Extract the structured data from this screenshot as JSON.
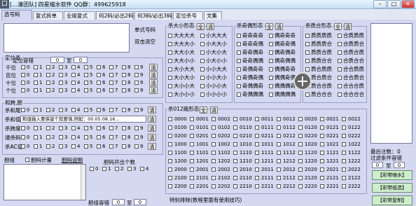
{
  "window": {
    "title": "[…清团队] 四星缩水软件 QQ群：499625918",
    "icon_char": "口"
  },
  "tabs": [
    {
      "label": "选号码"
    },
    {
      "label": "复式拆单"
    },
    {
      "label": "业级复式"
    },
    {
      "label": "何2码/必出2码"
    },
    {
      "label": "何3码/必出3码"
    },
    {
      "label": "定位杀号"
    },
    {
      "label": "文集"
    }
  ],
  "top_left": {
    "single_btn": "单式号码",
    "dbl_clear": "双击清空"
  },
  "dingwei": {
    "group_title": "定位杀",
    "tolerance_label": "定位容错",
    "tol_from": "0",
    "tol_to_label": "至",
    "tol_to": "0",
    "rows": [
      {
        "label": "千位"
      },
      {
        "label": "百位"
      },
      {
        "label": "十位"
      },
      {
        "label": "个位"
      }
    ],
    "digits": [
      "0",
      "1",
      "2",
      "3",
      "4",
      "5",
      "6",
      "7",
      "8",
      "9"
    ],
    "clear": "清"
  },
  "hehe": {
    "group_title": "和跨,胆",
    "rows": [
      {
        "label": "杀和尾"
      },
      {
        "label": "杀和值"
      },
      {
        "label": "杀跨度"
      },
      {
        "label": "通杀码"
      },
      {
        "label": "杀AC值"
      }
    ],
    "digits": [
      "0",
      "1",
      "2",
      "3",
      "4",
      "5",
      "6",
      "7",
      "8",
      "9"
    ],
    "sum_value_placeholder": "和值输入要保留个就要填,例如：00.05.08.16...",
    "clear": "清"
  },
  "danzu": {
    "label": "胆组",
    "code_count": "胆码计量",
    "explain": "胆码说明",
    "out_count": "胆码开出个数",
    "digits": [
      "0",
      "1",
      "2",
      "3",
      "4"
    ],
    "tolerance_label": "胆组容错",
    "tol_from": "0",
    "tol_to_label": "至",
    "tol_to": "0"
  },
  "daxiao": {
    "title": "杀大小形态",
    "all": "全",
    "clear": "清",
    "items": [
      "大大大大",
      "大大大小",
      "大大小大",
      "大大小小",
      "大小大大",
      "大小大小",
      "大小小大",
      "大小小小",
      "小大大大",
      "小大大小",
      "小大小大",
      "小大小小",
      "小小大大",
      "小小大小",
      "小小小大",
      "小小小小"
    ]
  },
  "jiou": {
    "title": "杀奇偶形态",
    "all": "全",
    "clear": "清",
    "items": [
      "奇奇奇奇",
      "奇奇奇偶",
      "奇奇偶奇",
      "奇奇偶偶",
      "奇偶奇奇",
      "奇偶奇偶",
      "奇偶偶奇",
      "奇偶偶偶",
      "偶奇奇奇",
      "偶奇奇偶",
      "偶奇偶奇",
      "偶奇偶偶",
      "偶偶奇奇",
      "偶偶奇偶",
      "偶偶偶奇",
      "偶偶偶偶"
    ]
  },
  "zhihe": {
    "title": "杀质合形态",
    "all": "全",
    "clear": "清",
    "items": [
      "质质质质",
      "质质质合",
      "质质合质",
      "质质合合",
      "质合质质",
      "质合质合",
      "质合合质",
      "质合合合",
      "合质质质",
      "合质质合",
      "合质合质",
      "合质合合",
      "合合质质",
      "合合质合",
      "合合合质",
      "合合合合"
    ]
  },
  "lu012": {
    "title": "杀012路形态",
    "all": "全",
    "clear": "清",
    "codes": [
      "0000",
      "0001",
      "0002",
      "0010",
      "0011",
      "0012",
      "0020",
      "0021",
      "0022",
      "0100",
      "0101",
      "0102",
      "0110",
      "0111",
      "0112",
      "0120",
      "0121",
      "0122",
      "0200",
      "0201",
      "0202",
      "0210",
      "0211",
      "0212",
      "0220",
      "0221",
      "0222",
      "1000",
      "1001",
      "1002",
      "1010",
      "1011",
      "1012",
      "1020",
      "1021",
      "1022",
      "1100",
      "1101",
      "1102",
      "1110",
      "1111",
      "1112",
      "1120",
      "1121",
      "1122",
      "1200",
      "1201",
      "1202",
      "1210",
      "1211",
      "1212",
      "1220",
      "1221",
      "1222",
      "2000",
      "2001",
      "2002",
      "2010",
      "2011",
      "2012",
      "2020",
      "2021",
      "2022",
      "2100",
      "2101",
      "2102",
      "2110",
      "2111",
      "2112",
      "2120",
      "2121",
      "2122",
      "2200",
      "2201",
      "2202",
      "2210",
      "2211",
      "2212",
      "2220",
      "2221",
      "2222"
    ]
  },
  "bottom_note": "特别排除(数程里面有使用技巧)",
  "right": {
    "last_count_label": "最后注数：",
    "last_count": "0",
    "filter_tol_label": "过滤条件容错",
    "filter_from": "0",
    "filter_to_label": "至",
    "filter_to": "0",
    "btn_shrink": "【彩带缩水】",
    "btn_group": "【彩带组选】",
    "btn_copy": "【彩带复制】"
  },
  "colors": {
    "panel": "#d4d8f0",
    "accent_green": "#cdeecd"
  }
}
